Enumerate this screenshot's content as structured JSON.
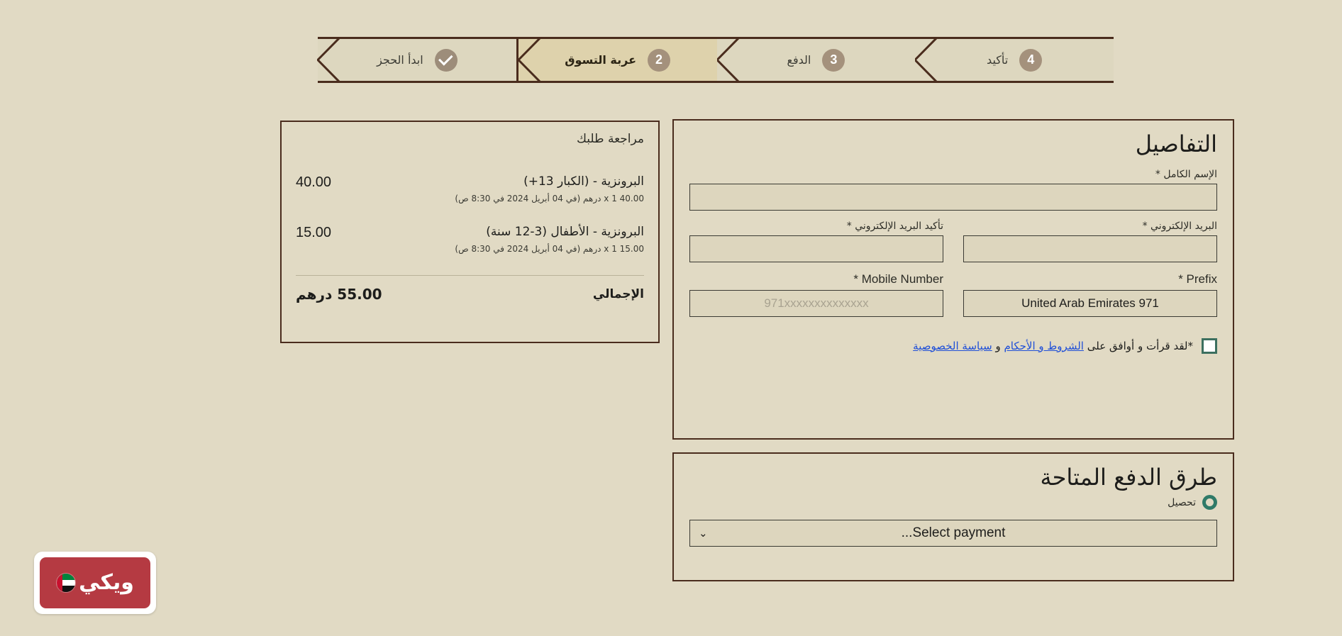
{
  "stepper": {
    "steps": [
      {
        "number": "4",
        "label": "تأكيد",
        "state": "pending"
      },
      {
        "number": "3",
        "label": "الدفع",
        "state": "pending"
      },
      {
        "number": "2",
        "label": "عربة التسوق",
        "state": "active"
      },
      {
        "number": "✔",
        "label": "ابدأ الحجز",
        "state": "done"
      }
    ]
  },
  "details": {
    "title": "التفاصيل",
    "full_name": {
      "label": "الإسم الكامل *",
      "value": "",
      "placeholder": ""
    },
    "email": {
      "label": "البريد الإلكتروني *",
      "value": "",
      "placeholder": ""
    },
    "email_confirm": {
      "label": "تأكيد البريد الإلكتروني *",
      "value": "",
      "placeholder": ""
    },
    "prefix": {
      "label": "Prefix *",
      "value": "United Arab Emirates 971"
    },
    "mobile": {
      "label": "Mobile Number *",
      "value": "",
      "placeholder": "971xxxxxxxxxxxxxx"
    },
    "terms": {
      "before": "لقد قرأت و أوافق على",
      "link_terms": "الشروط و الأحكام",
      "conjunction": "و",
      "link_privacy": "سياسة الخصوصية",
      "required_mark": "*",
      "checked": "false"
    }
  },
  "payment": {
    "title": "طرق الدفع المتاحة",
    "option_label": "تحصيل",
    "select_value": "Select payment...",
    "chevron": "⌄"
  },
  "summary": {
    "title": "مراجعة طلبك",
    "items": [
      {
        "name": "البرونزية - (الكبار 13+)",
        "price": "40.00",
        "detail": "x 1   40.00 درهم (في 04 أبريل 2024 في 8:30 ص)"
      },
      {
        "name": "البرونزية - الأطفال (3-12 سنة)",
        "price": "15.00",
        "detail": "x 1   15.00 درهم (في 04 أبريل 2024 في 8:30 ص)"
      }
    ],
    "total_label": "الإجمالي",
    "total_value": "55.00 درهم"
  },
  "logo": {
    "wordmark": "ويكي",
    "flag_icon": "uae-flag-icon"
  },
  "colors": {
    "page_bg": "#e1dac4",
    "panel_border": "#4a2c1d",
    "step_bg": "#ddd7bf",
    "step_active_bg": "#ded2ac",
    "step_circle": "#a4917c",
    "accent_green": "#2f7a68",
    "checkbox_green": "#3c6f5f",
    "link_blue": "#1f4fd8",
    "logo_red": "#b53a42"
  }
}
